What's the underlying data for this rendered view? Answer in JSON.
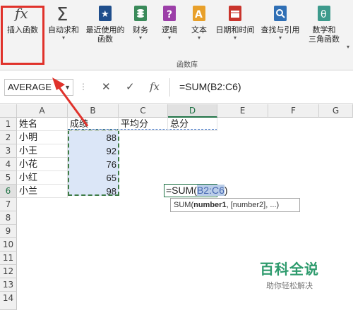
{
  "ribbon": {
    "buttons": [
      {
        "label": "插入函数",
        "icon": "fx-icon",
        "caret": ""
      },
      {
        "label": "自动求和",
        "icon": "sigma-icon",
        "caret": "▾"
      },
      {
        "label": "最近使用的\n函数",
        "icon": "star-book-icon",
        "caret": "▾"
      },
      {
        "label": "财务",
        "icon": "finance-book-icon",
        "caret": "▾"
      },
      {
        "label": "逻辑",
        "icon": "logic-book-icon",
        "caret": "▾"
      },
      {
        "label": "文本",
        "icon": "text-book-icon",
        "caret": "▾"
      },
      {
        "label": "日期和时间",
        "icon": "calendar-book-icon",
        "caret": "▾"
      },
      {
        "label": "查找与引用",
        "icon": "lookup-book-icon",
        "caret": "▾"
      },
      {
        "label": "数学和\n三角函数",
        "icon": "math-book-icon",
        "caret": "▾"
      }
    ],
    "group_label": "函数库"
  },
  "formula_bar": {
    "name_box": "AVERAGE",
    "cancel_glyph": "✕",
    "enter_glyph": "✓",
    "fx_glyph": "fx",
    "formula": "=SUM(B2:C6)"
  },
  "sheet": {
    "columns": [
      "A",
      "B",
      "C",
      "D",
      "E",
      "F",
      "G"
    ],
    "rows": [
      "1",
      "2",
      "3",
      "4",
      "5",
      "6",
      "7",
      "8",
      "9",
      "10",
      "11",
      "12",
      "13",
      "14"
    ],
    "headers": {
      "a1": "姓名",
      "b1": "成绩",
      "c1": "平均分",
      "d1": "总分"
    },
    "names": [
      "小明",
      "小王",
      "小花",
      "小红",
      "小兰"
    ],
    "scores": [
      "88",
      "92",
      "76",
      "65",
      "98"
    ],
    "active_cell": {
      "prefix": "=SUM(",
      "ref": "B2:C6",
      "suffix": ")"
    },
    "tooltip": {
      "func": "SUM(",
      "arg1": "number1",
      "rest": ", [number2], ...)"
    }
  },
  "watermark": {
    "main": "百科全说",
    "sub": "助你轻松解决"
  },
  "colors": {
    "accent_red": "#e0322b",
    "excel_green": "#217346",
    "watermark_green": "#2e9b6d"
  }
}
